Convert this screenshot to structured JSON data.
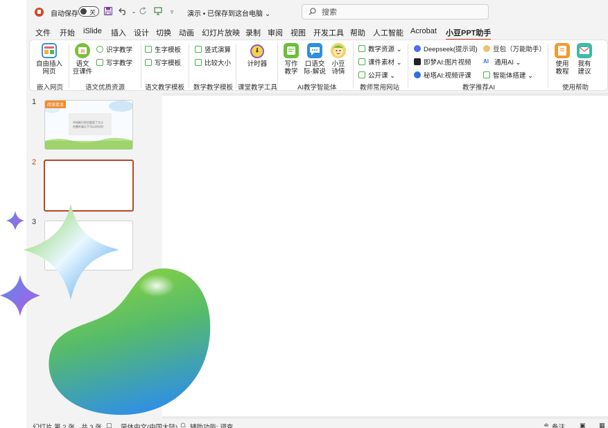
{
  "titlebar": {
    "autosave_label": "自动保存",
    "autosave_state": "关",
    "doc_title": "演示 • 已保存到这台电脑 ⌄",
    "search_placeholder": "搜索"
  },
  "tabs": [
    "文件",
    "开始",
    "iSlide",
    "插入",
    "设计",
    "切换",
    "动画",
    "幻灯片放映",
    "录制",
    "审阅",
    "视图",
    "开发工具",
    "帮助",
    "人工智能",
    "Acrobat",
    "小豆PPT助手"
  ],
  "active_tab": "小豆PPT助手",
  "ribbon": {
    "groups": {
      "embed": {
        "label": "嵌入网页",
        "btn": "自由插入\n网页",
        "btn_l1": "自由插入",
        "btn_l2": "网页"
      },
      "chinese": {
        "label": "语文优质资源",
        "big_l1": "语文",
        "big_l2": "豆课件",
        "small1": "识字教学",
        "small2": "写字教学"
      },
      "chinese_tpl": {
        "label": "语文教学模板",
        "small1": "生字模板",
        "small2": "写字模板"
      },
      "math_tpl": {
        "label": "数学教学模板",
        "small1": "竖式演算",
        "small2": "比较大小"
      },
      "class_tools": {
        "label": "课堂教学工具",
        "big": "计时器"
      },
      "ai_agent": {
        "label": "AI教学智能体",
        "b1_l1": "写作",
        "b1_l2": "教学",
        "b2_l1": "口语交",
        "b2_l2": "际-解说",
        "b3_l1": "小豆",
        "b3_l2": "诗情"
      },
      "sites": {
        "label": "教师常用网站",
        "s1": "教学资源 ⌄",
        "s2": "课件素材 ⌄",
        "s3": "公开课 ⌄"
      },
      "ai_rec": {
        "label": "教学推荐AI",
        "s1": "Deepseek(提示词)",
        "s2": "即梦AI:图片视频",
        "s3": "秘塔AI:视频评课",
        "s4": "豆包（万能助手）",
        "s5": "通用AI ⌄",
        "s6": "智能体搭建 ⌄"
      },
      "help": {
        "label": "使用帮助",
        "b1_l1": "使用",
        "b1_l2": "教程",
        "b2_l1": "我有",
        "b2_l2": "建议"
      }
    }
  },
  "thumbnails": [
    {
      "num": "1",
      "tag": "阅读接龙",
      "text1": "中间框行的空星里了大小",
      "text2": "在圈外展示下可以对对对"
    },
    {
      "num": "2"
    },
    {
      "num": "3"
    }
  ],
  "statusbar": {
    "slide_info": "幻灯片 第 2 张，共 3 张",
    "language": "简体中文(中国大陆)",
    "accessibility": "辅助功能: 调查",
    "notes": "备注"
  },
  "colors": {
    "accent": "#c43e1c",
    "ribbon_bg": "#ffffff",
    "window_bg": "#f3f3f3"
  }
}
